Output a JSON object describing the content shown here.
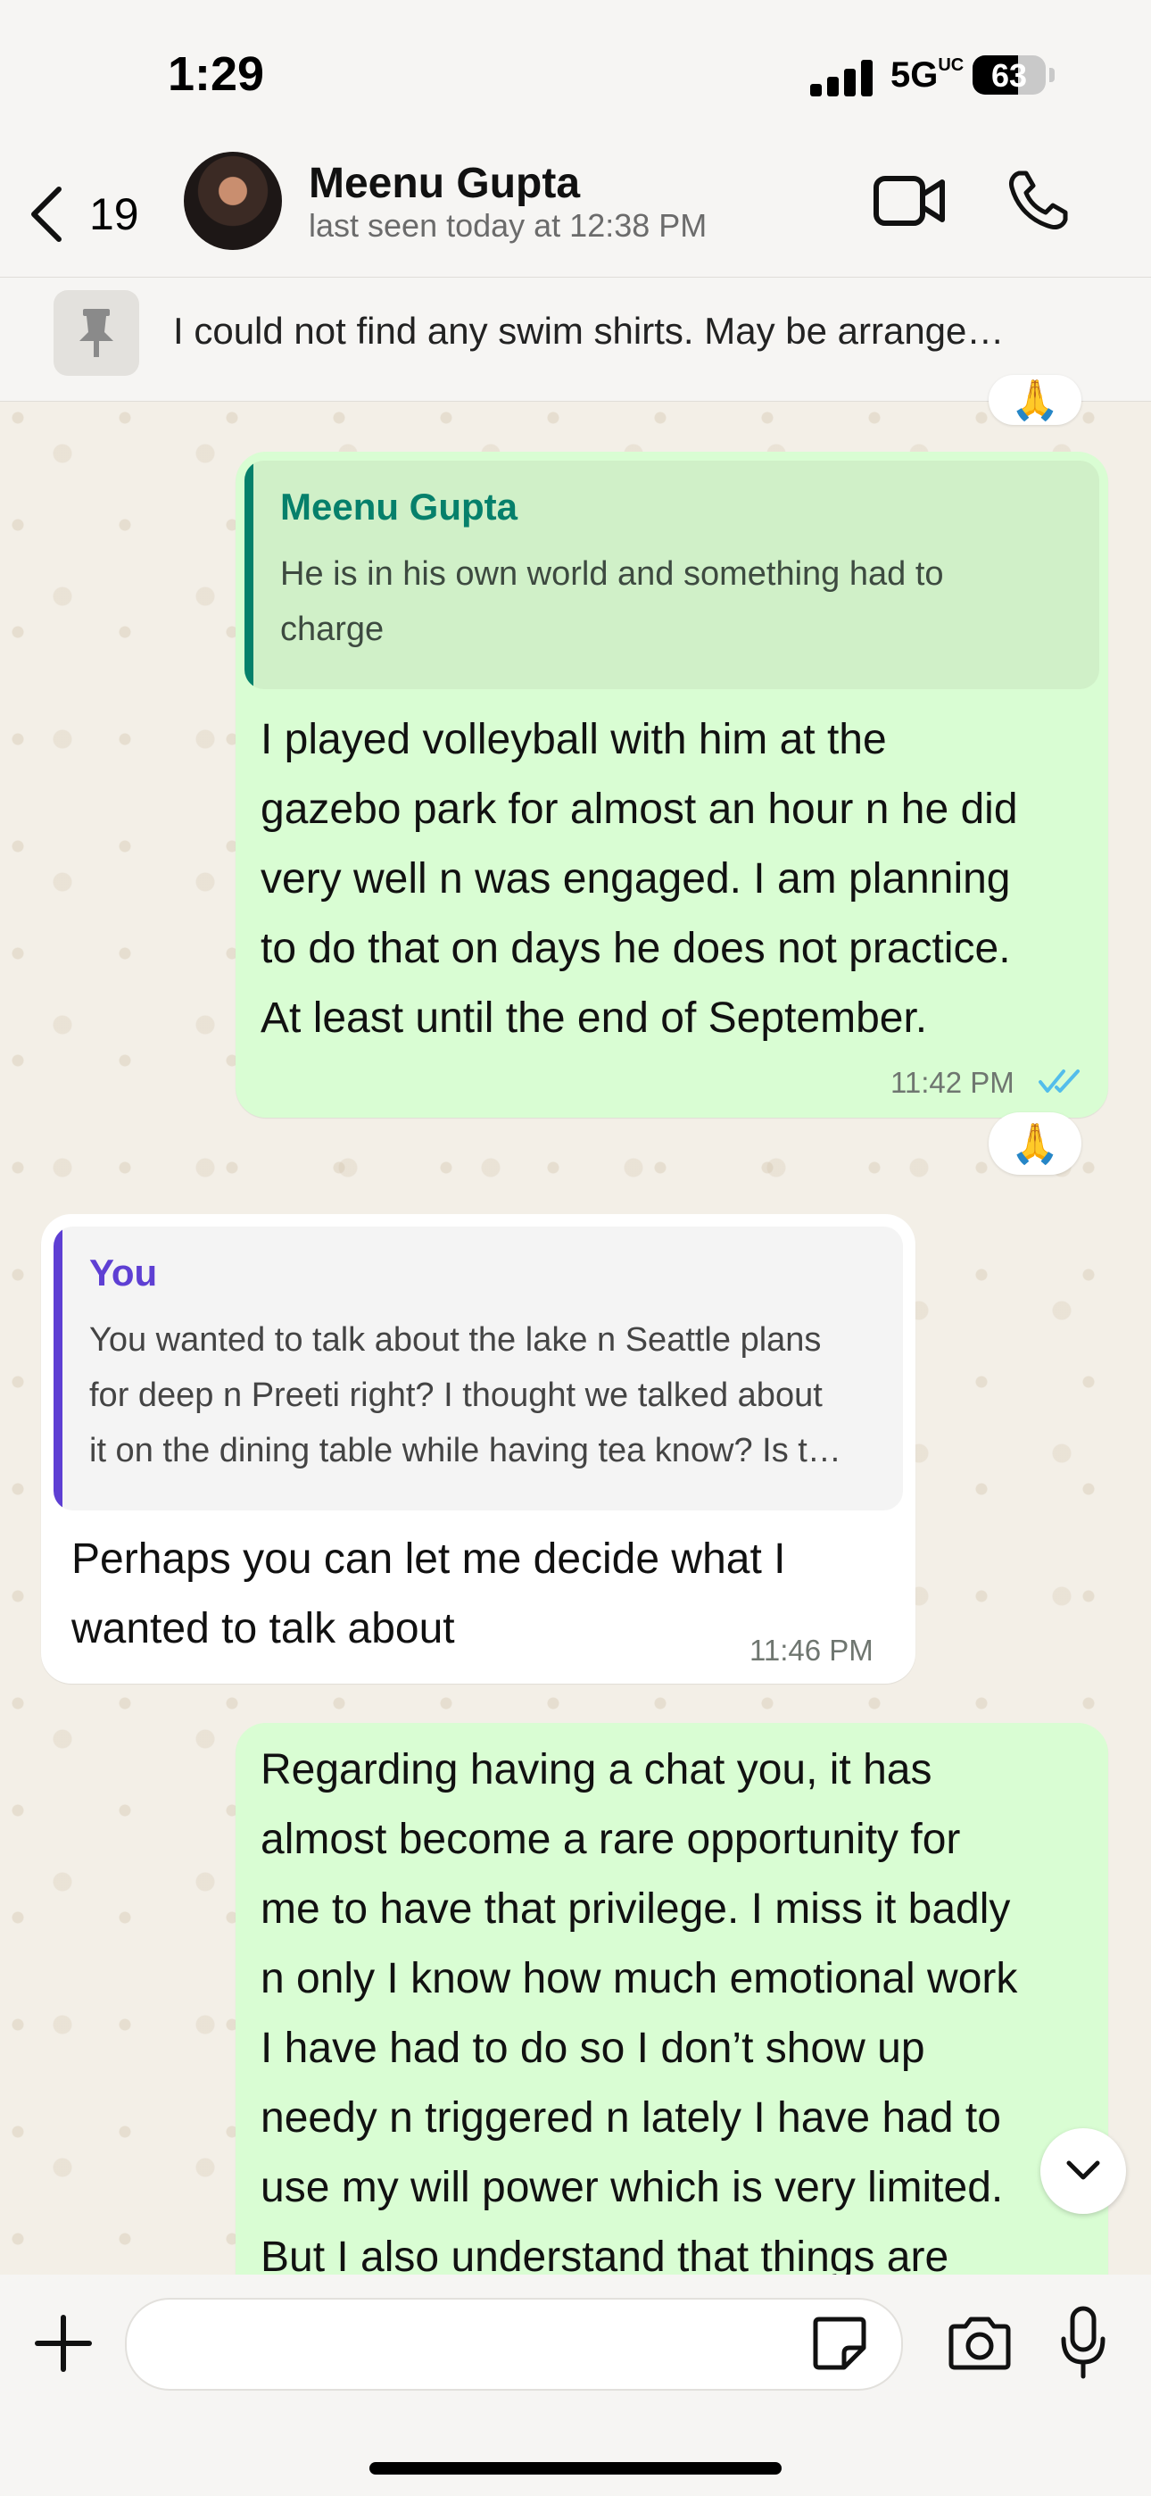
{
  "status_bar": {
    "time": "1:29",
    "network": "5G",
    "network_suffix": "UC",
    "battery": "63"
  },
  "header": {
    "back_count": "19",
    "contact_name": "Meenu Gupta",
    "contact_status": "last seen today at 12:38 PM"
  },
  "pinned": {
    "text": "I could not find any swim shirts. May be arrange…"
  },
  "messages": [
    {
      "direction": "outgoing",
      "quote_author": "Meenu Gupta",
      "quote_lines": [
        "He is in his own world and something had to",
        "charge"
      ],
      "lines": [
        "I played volleyball with him at the",
        "gazebo park for almost an hour n he did",
        "very well n was engaged. I am planning",
        "to do that on days he does not practice.",
        "At least until the end of September."
      ],
      "time": "11:42 PM",
      "reaction": "🙏"
    },
    {
      "direction": "incoming",
      "quote_author": "You",
      "quote_lines": [
        "You wanted to talk about the lake n Seattle plans",
        "for deep n Preeti right? I thought we talked about",
        "it on the dining table while having tea know? Is t…"
      ],
      "lines": [
        "Perhaps you can let me decide what I",
        "wanted to talk about"
      ],
      "time": "11:46 PM"
    },
    {
      "direction": "outgoing",
      "lines": [
        "Regarding having a chat you, it has",
        "almost become a rare opportunity for",
        "me to have that privilege. I miss it badly",
        "n only I know how much emotional work",
        "I have had to do so I don’t show up",
        "needy n triggered n lately I have had to",
        "use my will power which is very limited.",
        "But I also understand that things are"
      ]
    }
  ],
  "top_reaction": "🙏",
  "colors": {
    "outgoing_bubble": "#d9fdd3",
    "incoming_bubble": "#ffffff",
    "quote_green": "#06806b",
    "quote_purple": "#5e3fd3",
    "read_ticks": "#53bdeb"
  },
  "icons": [
    "chevron-left-icon",
    "video-call-icon",
    "phone-icon",
    "pin-icon",
    "plus-icon",
    "sticker-icon",
    "camera-icon",
    "microphone-icon",
    "chevron-down-icon",
    "double-check-icon"
  ]
}
